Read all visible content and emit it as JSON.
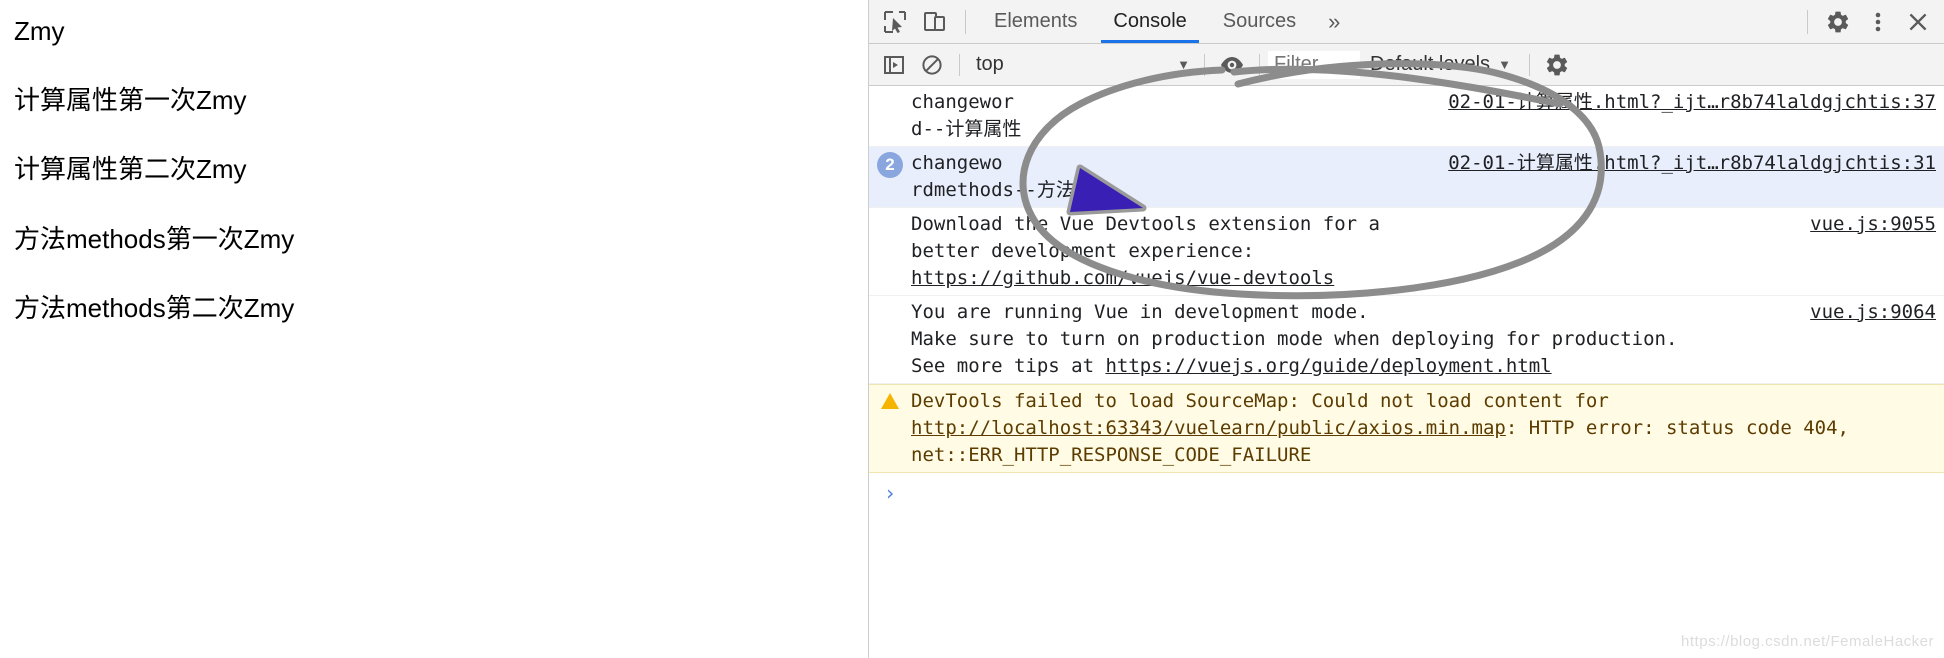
{
  "page": {
    "lines": [
      "Zmy",
      "计算属性第一次Zmy",
      "计算属性第二次Zmy",
      "方法methods第一次Zmy",
      "方法methods第二次Zmy"
    ]
  },
  "devtools": {
    "tabs": [
      {
        "label": "Elements",
        "active": false
      },
      {
        "label": "Console",
        "active": true
      },
      {
        "label": "Sources",
        "active": false
      }
    ],
    "more_label": "»",
    "toolbar_icons": {
      "inspect": "inspect-element-icon",
      "device": "device-toolbar-icon",
      "settings": "gear-icon",
      "menu": "kebab-menu-icon",
      "close": "close-icon"
    },
    "filterbar": {
      "sidebar_icon": "console-sidebar-icon",
      "clear_icon": "clear-console-icon",
      "context": "top",
      "context_caret": "▼",
      "eye_icon": "live-expression-eye-icon",
      "filter_placeholder": "Filter",
      "filter_value": "",
      "levels": "Default levels",
      "levels_caret": "▼",
      "settings_icon": "console-settings-gear-icon"
    },
    "messages": [
      {
        "type": "log",
        "count": "",
        "text_line1": "changewor",
        "text_line2": "d--计算属性",
        "source": "02-01-计算属性.html?_ijt…r8b74laldgjchtis:37"
      },
      {
        "type": "log",
        "count": "2",
        "text_line1": "changewo",
        "text_line2": "rdmethods--方法",
        "source": "02-01-计算属性.html?_ijt…r8b74laldgjchtis:31"
      },
      {
        "type": "log",
        "count": "",
        "text_line1": "Download the Vue Devtools extension for a",
        "text_line2": "better development experience:",
        "link": "https://github.com/vuejs/vue-devtools",
        "source": "vue.js:9055"
      },
      {
        "type": "log",
        "count": "",
        "text_line1": "You are running Vue in development mode.",
        "text_line2": "Make sure to turn on production mode when deploying for production.",
        "text_line3": "See more tips at ",
        "link": "https://vuejs.org/guide/deployment.html",
        "source": "vue.js:9064"
      },
      {
        "type": "warning",
        "count": "",
        "text_line1": "DevTools failed to load SourceMap: Could not load content for ",
        "link": "http://localhost:63343/vuelearn/public/axios.min.map",
        "text_line2": ": HTTP error: status code 404, net::ERR_HTTP_RESPONSE_CODE_FAILURE",
        "source": ""
      }
    ],
    "prompt_caret": "›",
    "watermark": "https://blog.csdn.net/FemaleHacker"
  },
  "colors": {
    "accent": "#1a73e8",
    "badge": "#8aa6de",
    "warning_bg": "#fffbe5",
    "warning_icon": "#f4b400",
    "annotation": "#8c8c8c",
    "cursor": "#3a1fb5"
  }
}
